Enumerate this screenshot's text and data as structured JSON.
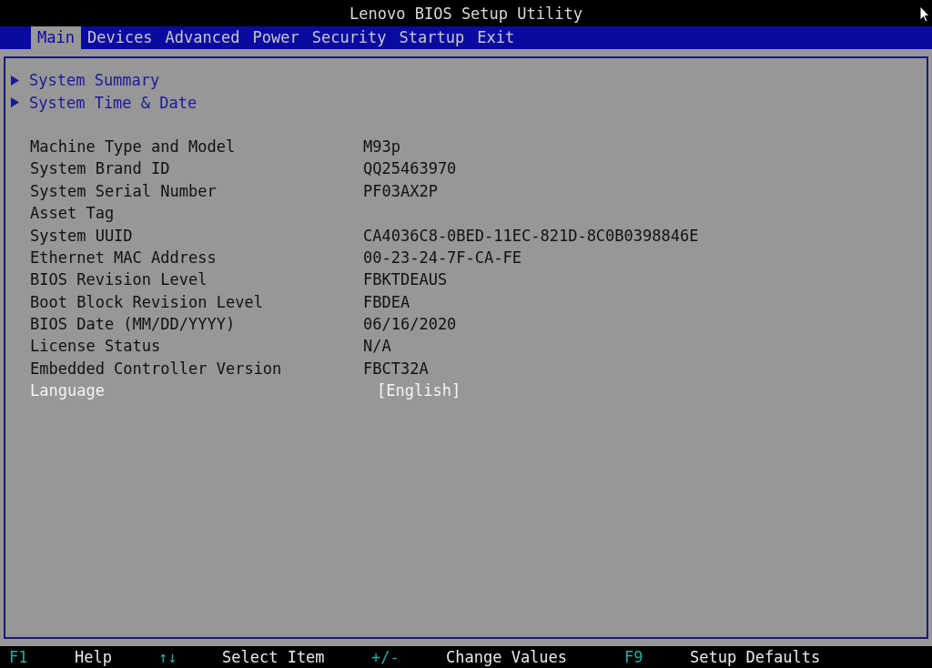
{
  "window": {
    "title": "Lenovo BIOS Setup Utility"
  },
  "tabs": [
    {
      "label": "Main",
      "selected": true
    },
    {
      "label": "Devices",
      "selected": false
    },
    {
      "label": "Advanced",
      "selected": false
    },
    {
      "label": "Power",
      "selected": false
    },
    {
      "label": "Security",
      "selected": false
    },
    {
      "label": "Startup",
      "selected": false
    },
    {
      "label": "Exit",
      "selected": false
    }
  ],
  "submenus": [
    {
      "label": "System Summary"
    },
    {
      "label": "System Time & Date"
    }
  ],
  "items": [
    {
      "kind": "info",
      "label": "Machine Type and Model",
      "value": "M93p"
    },
    {
      "kind": "info",
      "label": "System Brand ID",
      "value": "QQ25463970"
    },
    {
      "kind": "info",
      "label": "System Serial Number",
      "value": "PF03AX2P"
    },
    {
      "kind": "info",
      "label": "Asset Tag"
    },
    {
      "kind": "info",
      "label": "System UUID",
      "value": "CA4036C8-0BED-11EC-821D-8C0B0398846E"
    },
    {
      "kind": "info",
      "label": "Ethernet MAC Address",
      "value": "00-23-24-7F-CA-FE"
    },
    {
      "kind": "info",
      "label": "BIOS Revision Level",
      "value": "FBKTDEAUS"
    },
    {
      "kind": "info",
      "label": "Boot Block Revision Level",
      "value": "FBDEA"
    },
    {
      "kind": "info",
      "label": "BIOS Date (MM/DD/YYYY)",
      "value": "06/16/2020"
    },
    {
      "kind": "info",
      "label": "License Status",
      "value": "N/A"
    },
    {
      "kind": "info",
      "label": "Embedded Controller Version",
      "value": "FBCT32A"
    },
    {
      "kind": "setting",
      "label": "Language",
      "value": "[English]"
    }
  ],
  "status_bar": [
    {
      "key": "F1",
      "action": "Help"
    },
    {
      "key": "↑↓",
      "action": "Select Item"
    },
    {
      "key": "+/-",
      "action": "Change Values"
    },
    {
      "key": "F9",
      "action": "Setup Defaults"
    }
  ]
}
